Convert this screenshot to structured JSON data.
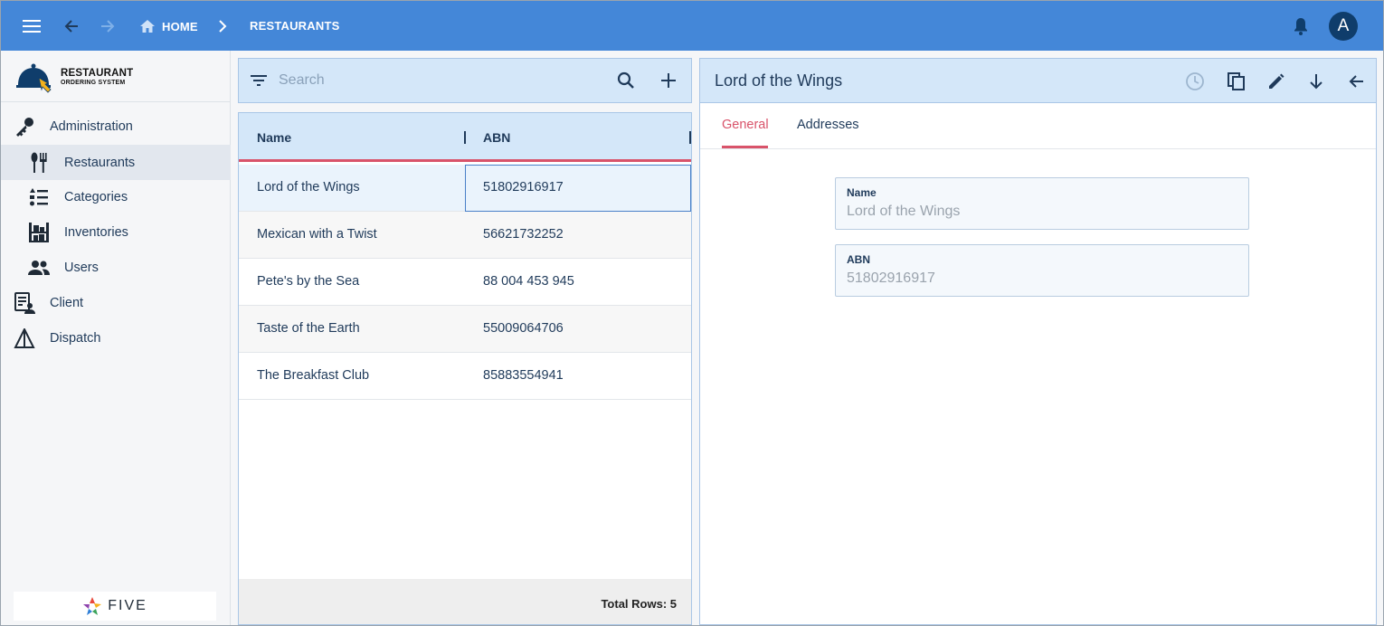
{
  "appbar": {
    "breadcrumbs": [
      "HOME",
      "RESTAURANTS"
    ],
    "avatar_initial": "A",
    "color": "#4487d8"
  },
  "logo": {
    "line1": "RESTAURANT",
    "line2": "ORDERING SYSTEM"
  },
  "sidebar": {
    "items": [
      {
        "label": "Administration",
        "icon": "key-icon"
      },
      {
        "label": "Restaurants",
        "icon": "dining-icon",
        "active": true
      },
      {
        "label": "Categories",
        "icon": "list-icon"
      },
      {
        "label": "Inventories",
        "icon": "shelves-icon"
      },
      {
        "label": "Users",
        "icon": "people-icon"
      },
      {
        "label": "Client",
        "icon": "client-form-icon"
      },
      {
        "label": "Dispatch",
        "icon": "dispatch-icon"
      }
    ],
    "footer_brand": "FIVE"
  },
  "list": {
    "search_placeholder": "Search",
    "columns": [
      "Name",
      "ABN"
    ],
    "rows": [
      {
        "name": "Lord of the Wings",
        "abn": "51802916917"
      },
      {
        "name": "Mexican with a Twist",
        "abn": "56621732252"
      },
      {
        "name": "Pete's by the Sea",
        "abn": "88 004 453 945"
      },
      {
        "name": "Taste of the Earth",
        "abn": "55009064706"
      },
      {
        "name": "The Breakfast Club",
        "abn": "85883554941"
      }
    ],
    "total_rows": "Total Rows: 5"
  },
  "detail": {
    "title": "Lord of the Wings",
    "tabs": [
      "General",
      "Addresses"
    ],
    "fields": [
      {
        "label": "Name",
        "value": "Lord of the Wings"
      },
      {
        "label": "ABN",
        "value": "51802916917"
      }
    ]
  },
  "colors": {
    "accent": "#d9536a",
    "panel_header": "#d4e7f9",
    "text": "#1f3a5a"
  }
}
